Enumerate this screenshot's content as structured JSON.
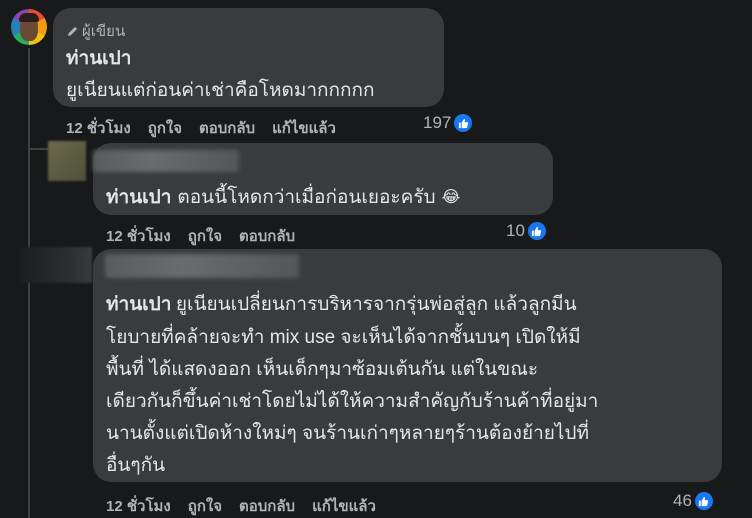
{
  "comments": [
    {
      "author_badge": "ผู้เขียน",
      "name": "ท่านเปา",
      "text": "ยูเนียนแต่ก่อนค่าเช่าคือโหดมากกกกก",
      "time": "12 ชั่วโมง",
      "like": "ถูกใจ",
      "reply": "ตอบกลับ",
      "edited": "แก้ไขแล้ว",
      "reactions": "197"
    },
    {
      "mention": "ท่านเปา",
      "text": "ตอนนี้โหดกว่าเมื่อก่อนเยอะครับ",
      "emoji": "😂",
      "time": "12 ชั่วโมง",
      "like": "ถูกใจ",
      "reply": "ตอบกลับ",
      "reactions": "10"
    },
    {
      "mention": "ท่านเปา",
      "lines": [
        "ยูเนียนเปลี่ยนการบริหารจากรุ่นพ่อสู่ลูก แล้วลูกมีน",
        "โยบายที่คล้ายจะทำ mix use จะเห็นได้จากชั้นบนๆ เปิดให้มี",
        "พื้นที่ ได้แสดงออก เห็นเด็กๆมาซ้อมเต้นกัน แต่ในขณะ",
        "เดียวกันก็ขึ้นค่าเช่าโดยไม่ได้ให้ความสำคัญกับร้านค้าที่อยู่มา",
        "นานตั้งแต่เปิดห้างใหม่ๆ จนร้านเก่าๆหลายๆร้านต้องย้ายไปที่",
        "อื่นๆกัน"
      ],
      "time": "12 ชั่วโมง",
      "like": "ถูกใจ",
      "reply": "ตอบกลับ",
      "edited": "แก้ไขแล้ว",
      "reactions": "46"
    }
  ],
  "colors": {
    "bg": "#18191a",
    "bubble": "#3a3b3c",
    "like": "#1877f2",
    "muted": "#b0b3b8"
  },
  "icons": {
    "badge": "pencil-icon",
    "reaction": "thumbs-up-icon"
  }
}
